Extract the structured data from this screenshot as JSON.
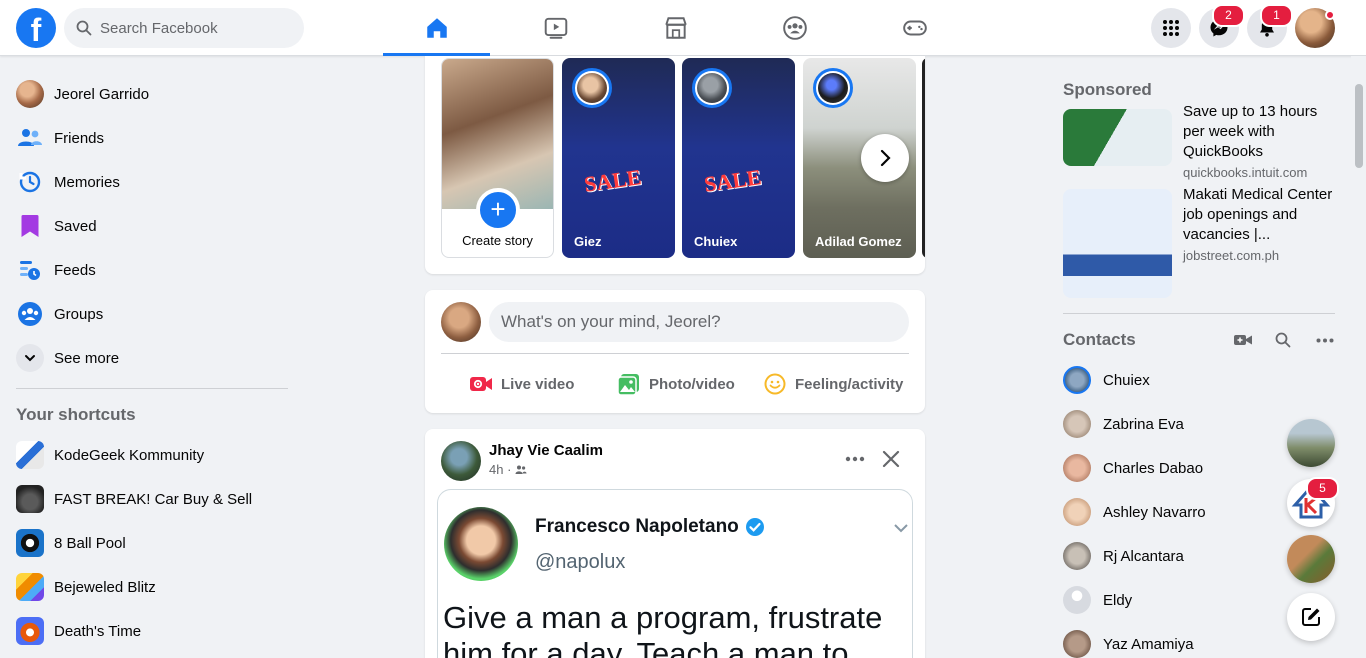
{
  "topbar": {
    "logo_letter": "f",
    "search_placeholder": "Search Facebook",
    "nav_tabs": [
      {
        "name": "home",
        "icon": "home-icon",
        "active": true
      },
      {
        "name": "watch",
        "icon": "video-play-icon",
        "active": false
      },
      {
        "name": "marketplace",
        "icon": "store-icon",
        "active": false
      },
      {
        "name": "groups",
        "icon": "groups-icon",
        "active": false
      },
      {
        "name": "gaming",
        "icon": "gamepad-icon",
        "active": false
      }
    ],
    "messenger_badge": "2",
    "notifications_badge": "1",
    "accent": "#1877f2"
  },
  "leftnav": {
    "items": [
      {
        "label": "Jeorel Garrido"
      },
      {
        "label": "Friends"
      },
      {
        "label": "Memories"
      },
      {
        "label": "Saved"
      },
      {
        "label": "Feeds"
      },
      {
        "label": "Groups"
      },
      {
        "label": "See more"
      }
    ],
    "shortcuts_title": "Your shortcuts",
    "shortcuts": [
      {
        "label": "KodeGeek Kommunity"
      },
      {
        "label": "FAST BREAK! Car Buy & Sell"
      },
      {
        "label": "8 Ball Pool"
      },
      {
        "label": "Bejeweled Blitz"
      },
      {
        "label": "Death's Time"
      }
    ]
  },
  "stories": {
    "create_label": "Create story",
    "items": [
      {
        "name": "Giez",
        "overlay": "SALE"
      },
      {
        "name": "Chuiex",
        "overlay": "SALE"
      },
      {
        "name": "Adilad Gomez"
      }
    ]
  },
  "composer": {
    "placeholder": "What's on your mind, Jeorel?",
    "actions": [
      {
        "label": "Live video",
        "color": "#f02849"
      },
      {
        "label": "Photo/video",
        "color": "#45bd62"
      },
      {
        "label": "Feeling/activity",
        "color": "#f7b928"
      }
    ]
  },
  "post": {
    "author": "Jhay Vie Caalim",
    "time": "4h",
    "tweet": {
      "name": "Francesco Napoletano",
      "handle": "@napolux",
      "text": "Give a man a program, frustrate him for a day. Teach a man to"
    }
  },
  "right": {
    "sponsored_title": "Sponsored",
    "ads": [
      {
        "title": "Save up to 13 hours per week with QuickBooks",
        "domain": "quickbooks.intuit.com"
      },
      {
        "title": "Makati Medical Center job openings and vacancies |...",
        "domain": "jobstreet.com.ph"
      }
    ],
    "contacts_title": "Contacts",
    "contacts": [
      {
        "name": "Chuiex"
      },
      {
        "name": "Zabrina Eva"
      },
      {
        "name": "Charles Dabao"
      },
      {
        "name": "Ashley Navarro"
      },
      {
        "name": "Rj Alcantara"
      },
      {
        "name": "Eldy"
      },
      {
        "name": "Yaz Amamiya"
      }
    ]
  },
  "bubbles": {
    "k_badge": "5"
  }
}
